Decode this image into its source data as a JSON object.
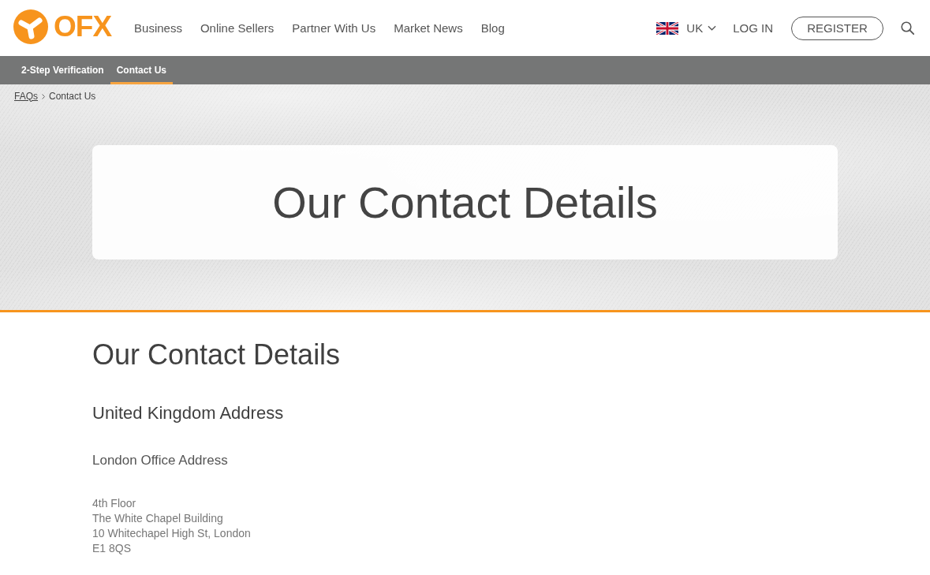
{
  "header": {
    "logo": "OFX",
    "nav": [
      "Business",
      "Online Sellers",
      "Partner With Us",
      "Market News",
      "Blog"
    ],
    "region": {
      "label": "UK"
    },
    "login": "LOG IN",
    "register": "REGISTER"
  },
  "subnav": [
    {
      "label": "2-Step Verification",
      "selected": false
    },
    {
      "label": "Contact Us",
      "selected": true
    }
  ],
  "breadcrumb": [
    {
      "label": "FAQs",
      "kind": "link"
    },
    {
      "label": "Contact Us",
      "kind": "current"
    }
  ],
  "hero": {
    "title": "Our Contact Details"
  },
  "content": {
    "title": "Our Contact Details",
    "sections": [
      {
        "heading": "United Kingdom Address",
        "offices": [
          {
            "name": "London Office Address",
            "address": [
              "4th Floor",
              "The White Chapel Building",
              "10 Whitechapel High St, London",
              "E1 8QS"
            ]
          }
        ]
      }
    ]
  }
}
